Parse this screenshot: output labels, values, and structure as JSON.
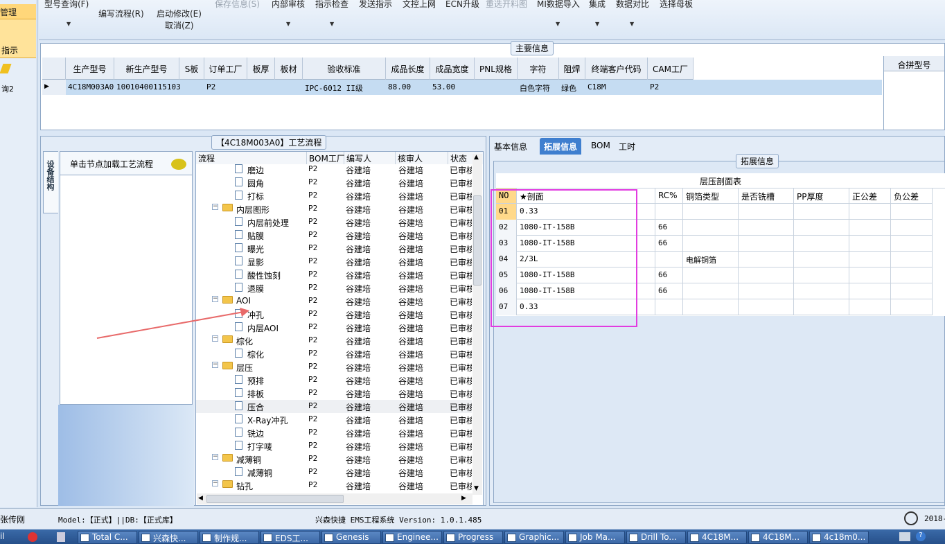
{
  "left_strip": {
    "item1": "管理",
    "item2": "指示",
    "item3": "询2"
  },
  "toolbar": {
    "items": [
      {
        "label": "型号查询(F)"
      },
      {
        "label": "编写流程(R)"
      },
      {
        "label": "启动修改(E)"
      },
      {
        "label": "取消(Z)"
      },
      {
        "label": "保存信息(S)"
      },
      {
        "label": "内部审核"
      },
      {
        "label": "指示检查"
      },
      {
        "label": "发送指示"
      },
      {
        "label": "文控上网"
      },
      {
        "label": "ECN升级"
      },
      {
        "label": "重选开料图"
      },
      {
        "label": "MI数据导入"
      },
      {
        "label": "集成"
      },
      {
        "label": "数据对比"
      },
      {
        "label": "选择母板"
      }
    ]
  },
  "main_info": {
    "title": "主要信息",
    "merge_title": "合拼型号",
    "columns": [
      "生产型号",
      "新生产型号",
      "S板",
      "订单工厂",
      "板厚",
      "板材",
      "验收标准",
      "成品长度",
      "成品宽度",
      "PNL规格",
      "字符",
      "阻焊",
      "终端客户代码",
      "CAM工厂"
    ],
    "row": [
      "4C18M003A0",
      "10010400115103",
      "",
      "P2",
      "",
      "",
      "IPC-6012 II级",
      "88.00",
      "53.00",
      "",
      "白色字符",
      "绿色",
      "C18M",
      "P2"
    ]
  },
  "flow_panel": {
    "title": "【4C18M003A0】工艺流程",
    "side_tab": "设备结构",
    "hint": "单击节点加载工艺流程",
    "columns": [
      "流程",
      "BOM工厂",
      "编写人",
      "核审人",
      "状态"
    ],
    "rows": [
      {
        "name": "磨边",
        "level": 2,
        "type": "doc",
        "bom": "P2",
        "writer": "谷建培",
        "reviewer": "谷建培",
        "status": "已审核"
      },
      {
        "name": "圆角",
        "level": 2,
        "type": "doc",
        "bom": "P2",
        "writer": "谷建培",
        "reviewer": "谷建培",
        "status": "已审核"
      },
      {
        "name": "打标",
        "level": 2,
        "type": "doc",
        "bom": "P2",
        "writer": "谷建培",
        "reviewer": "谷建培",
        "status": "已审核"
      },
      {
        "name": "内层图形",
        "level": 1,
        "type": "folder",
        "bom": "P2",
        "writer": "谷建培",
        "reviewer": "谷建培",
        "status": "已审核"
      },
      {
        "name": "内层前处理",
        "level": 2,
        "type": "doc",
        "bom": "P2",
        "writer": "谷建培",
        "reviewer": "谷建培",
        "status": "已审核"
      },
      {
        "name": "贴膜",
        "level": 2,
        "type": "doc",
        "bom": "P2",
        "writer": "谷建培",
        "reviewer": "谷建培",
        "status": "已审核"
      },
      {
        "name": "曝光",
        "level": 2,
        "type": "doc",
        "bom": "P2",
        "writer": "谷建培",
        "reviewer": "谷建培",
        "status": "已审核"
      },
      {
        "name": "显影",
        "level": 2,
        "type": "doc",
        "bom": "P2",
        "writer": "谷建培",
        "reviewer": "谷建培",
        "status": "已审核"
      },
      {
        "name": "酸性蚀刻",
        "level": 2,
        "type": "doc",
        "bom": "P2",
        "writer": "谷建培",
        "reviewer": "谷建培",
        "status": "已审核"
      },
      {
        "name": "退膜",
        "level": 2,
        "type": "doc",
        "bom": "P2",
        "writer": "谷建培",
        "reviewer": "谷建培",
        "status": "已审核"
      },
      {
        "name": "AOI",
        "level": 1,
        "type": "folder",
        "bom": "P2",
        "writer": "谷建培",
        "reviewer": "谷建培",
        "status": "已审核"
      },
      {
        "name": "冲孔",
        "level": 2,
        "type": "doc",
        "bom": "P2",
        "writer": "谷建培",
        "reviewer": "谷建培",
        "status": "已审核"
      },
      {
        "name": "内层AOI",
        "level": 2,
        "type": "doc",
        "bom": "P2",
        "writer": "谷建培",
        "reviewer": "谷建培",
        "status": "已审核"
      },
      {
        "name": "棕化",
        "level": 1,
        "type": "folder",
        "bom": "P2",
        "writer": "谷建培",
        "reviewer": "谷建培",
        "status": "已审核"
      },
      {
        "name": "棕化",
        "level": 2,
        "type": "doc",
        "bom": "P2",
        "writer": "谷建培",
        "reviewer": "谷建培",
        "status": "已审核"
      },
      {
        "name": "层压",
        "level": 1,
        "type": "folder",
        "bom": "P2",
        "writer": "谷建培",
        "reviewer": "谷建培",
        "status": "已审核"
      },
      {
        "name": "预排",
        "level": 2,
        "type": "doc",
        "bom": "P2",
        "writer": "谷建培",
        "reviewer": "谷建培",
        "status": "已审核"
      },
      {
        "name": "排板",
        "level": 2,
        "type": "doc",
        "bom": "P2",
        "writer": "谷建培",
        "reviewer": "谷建培",
        "status": "已审核"
      },
      {
        "name": "压合",
        "level": 2,
        "type": "doc",
        "bom": "P2",
        "writer": "谷建培",
        "reviewer": "谷建培",
        "status": "已审核"
      },
      {
        "name": "X-Ray冲孔",
        "level": 2,
        "type": "doc",
        "bom": "P2",
        "writer": "谷建培",
        "reviewer": "谷建培",
        "status": "已审核"
      },
      {
        "name": "铣边",
        "level": 2,
        "type": "doc",
        "bom": "P2",
        "writer": "谷建培",
        "reviewer": "谷建培",
        "status": "已审核"
      },
      {
        "name": "打字唛",
        "level": 2,
        "type": "doc",
        "bom": "P2",
        "writer": "谷建培",
        "reviewer": "谷建培",
        "status": "已审核"
      },
      {
        "name": "减薄铜",
        "level": 1,
        "type": "folder",
        "bom": "P2",
        "writer": "谷建培",
        "reviewer": "谷建培",
        "status": "已审核"
      },
      {
        "name": "减薄铜",
        "level": 2,
        "type": "doc",
        "bom": "P2",
        "writer": "谷建培",
        "reviewer": "谷建培",
        "status": "已审核"
      },
      {
        "name": "钻孔",
        "level": 1,
        "type": "folder",
        "bom": "P2",
        "writer": "谷建培",
        "reviewer": "谷建培",
        "status": "已审核"
      }
    ]
  },
  "right_panel": {
    "tabs": [
      "基本信息",
      "拓展信息",
      "BOM",
      "工时"
    ],
    "active_tab": "拓展信息",
    "section_title": "拓展信息",
    "table_title": "层压剖面表",
    "columns": [
      "NO",
      "★剖面",
      "",
      "RC%",
      "铜箔类型",
      "是否铣槽",
      "PP厚度",
      "正公差",
      "负公差"
    ],
    "rows": [
      [
        "01",
        "0.33",
        "",
        "",
        "",
        "",
        "",
        "",
        ""
      ],
      [
        "02",
        "1080-IT-158B",
        "",
        "66",
        "",
        "",
        "",
        "",
        ""
      ],
      [
        "03",
        "1080-IT-158B",
        "",
        "66",
        "",
        "",
        "",
        "",
        ""
      ],
      [
        "04",
        "2/3L",
        "",
        "",
        "电解铜箔",
        "",
        "",
        "",
        ""
      ],
      [
        "05",
        "1080-IT-158B",
        "",
        "66",
        "",
        "",
        "",
        "",
        ""
      ],
      [
        "06",
        "1080-IT-158B",
        "",
        "66",
        "",
        "",
        "",
        "",
        ""
      ],
      [
        "07",
        "0.33",
        "",
        "",
        "",
        "",
        "",
        "",
        ""
      ]
    ]
  },
  "status_bar": {
    "user": "张传刚",
    "model_db": "Model:【正式】||DB:【正式库】",
    "system": "兴森快捷 EMS工程系统 Version: 1.0.1.485",
    "date": "2018-"
  },
  "taskbar": {
    "items": [
      "Total C...",
      "兴森快...",
      "制作规...",
      "EDS工...",
      "Genesis",
      "Enginee...",
      "Progress",
      "Graphic...",
      "Job Ma...",
      "Drill To...",
      "4C18M...",
      "4C18M...",
      "4c18m0..."
    ],
    "left_text": "il"
  },
  "colors": {
    "highlight_box": "#e23ce0",
    "arrow": "#e86a6a",
    "accent": "#3f7fcf"
  }
}
